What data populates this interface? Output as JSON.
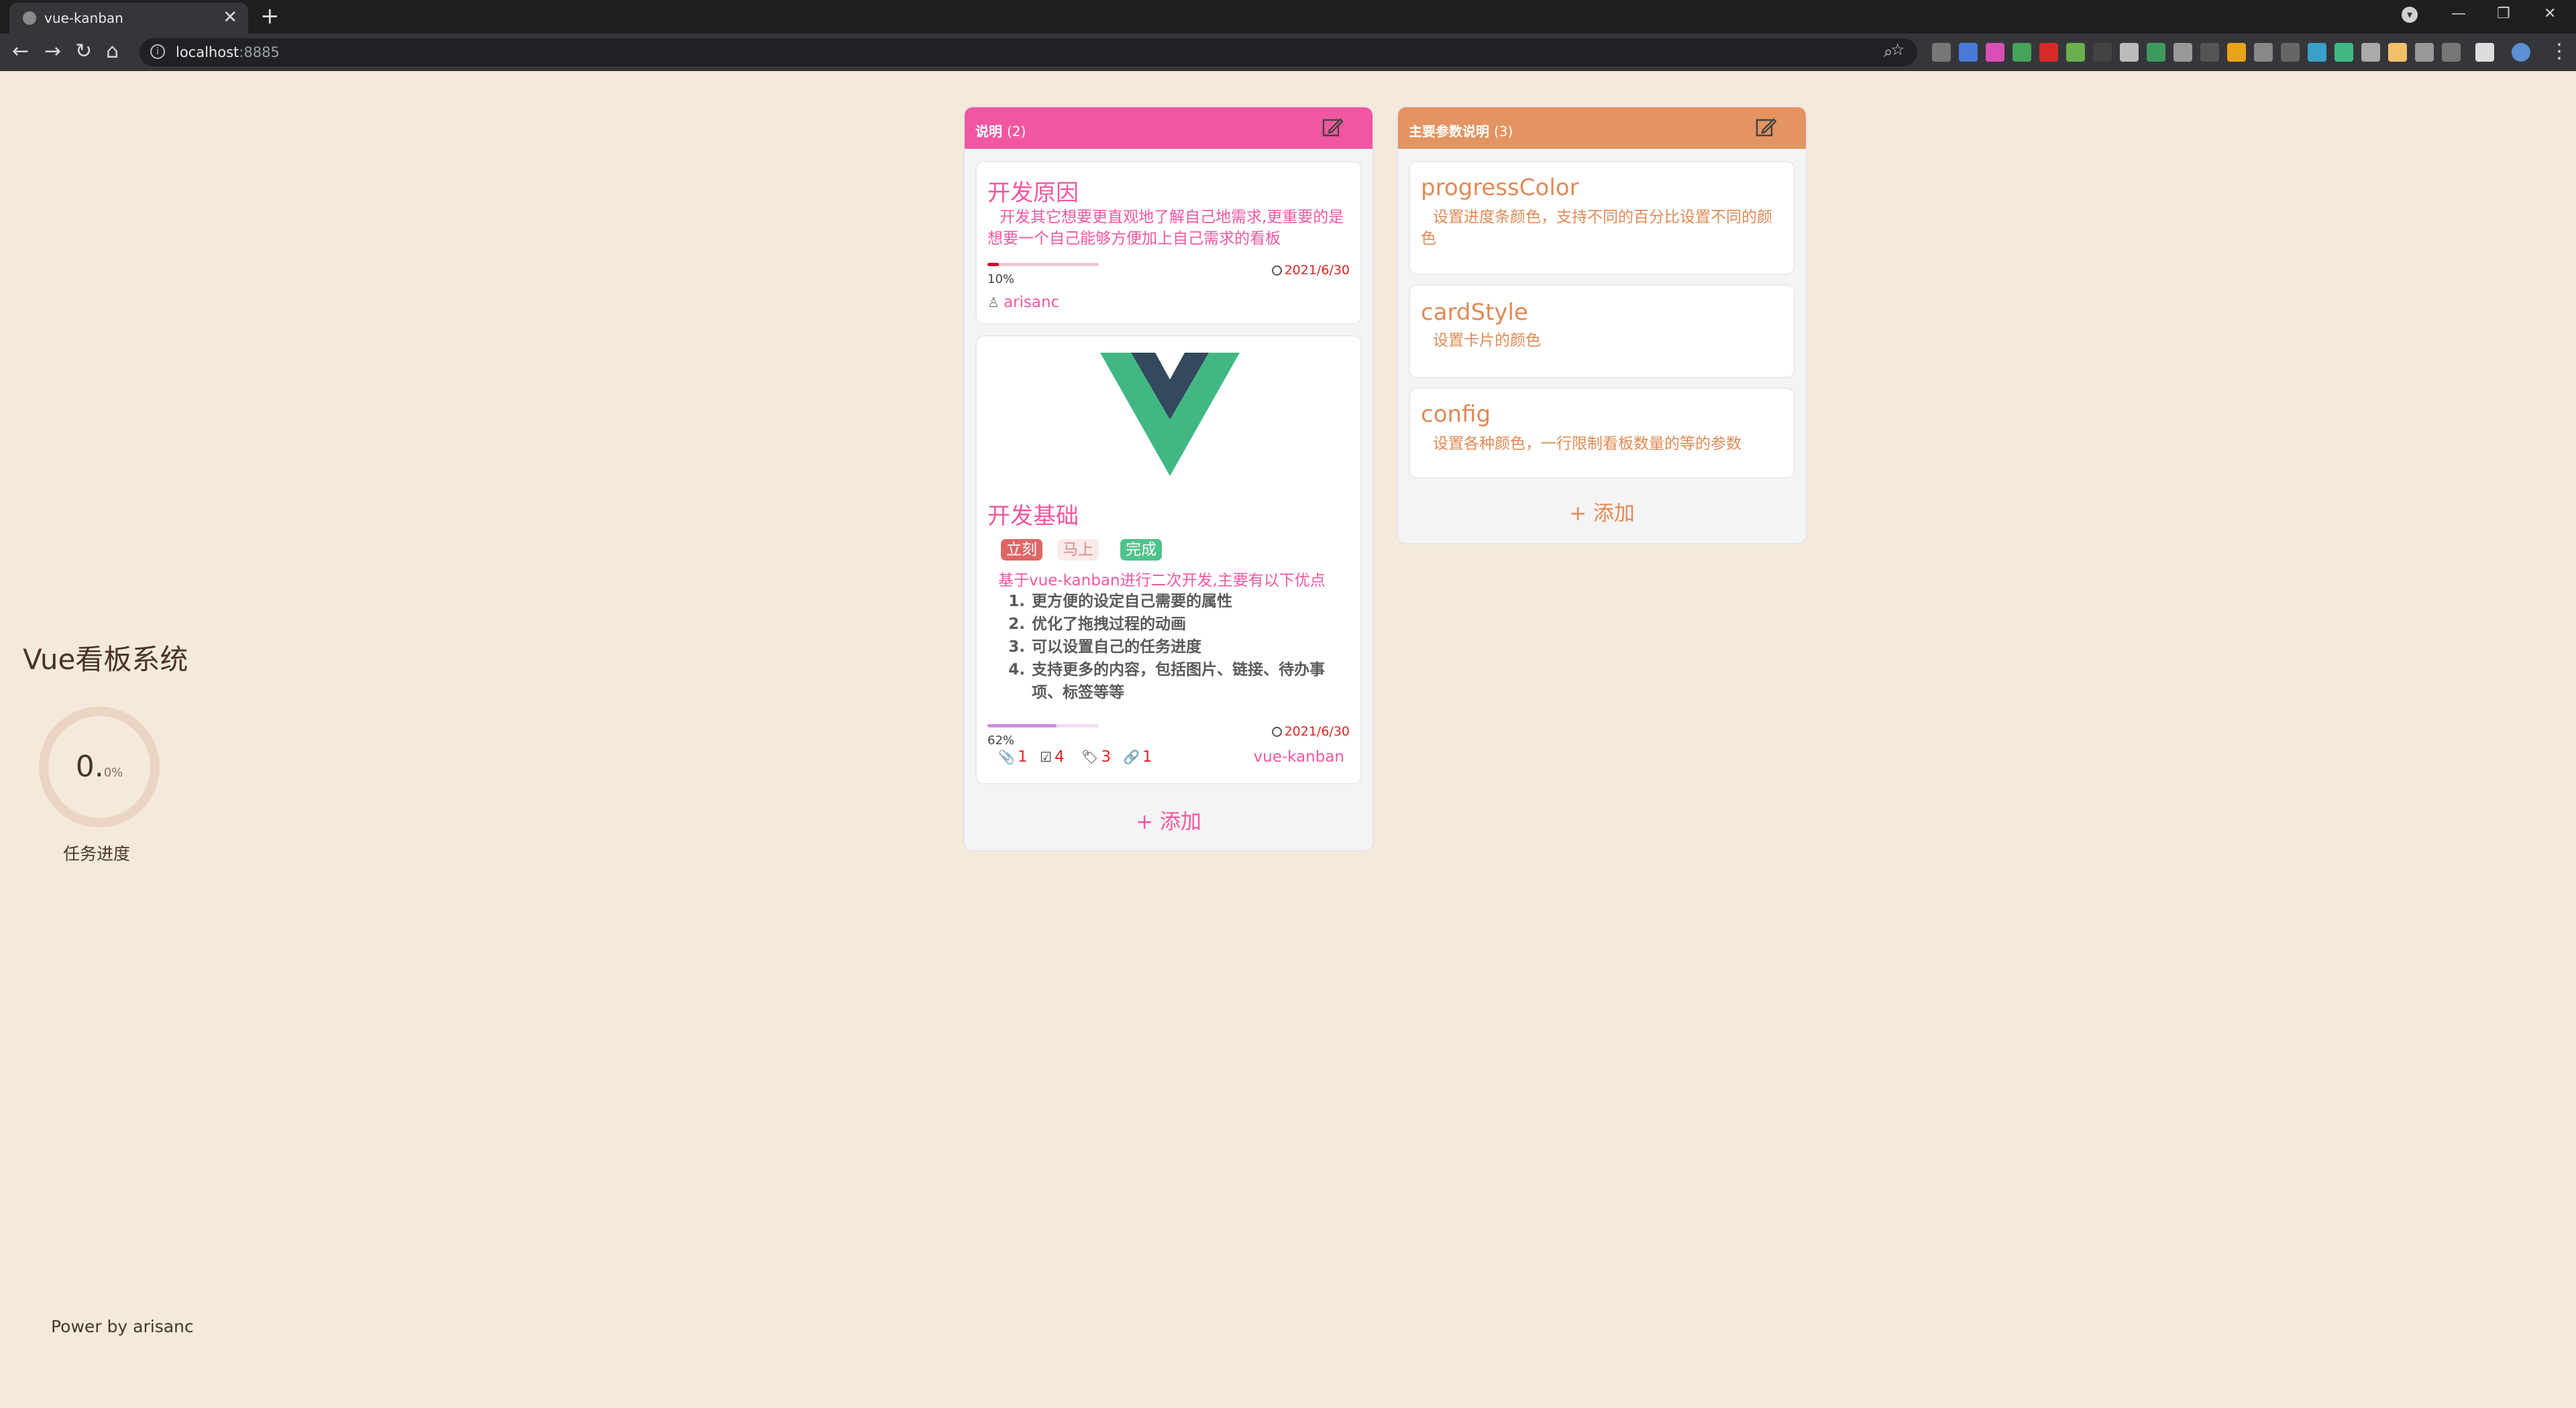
{
  "browser": {
    "tab_title": "vue-kanban",
    "url_host": "localhost",
    "url_port": ":8885"
  },
  "side": {
    "title": "Vue看板系统",
    "progress_value": "0.",
    "progress_decimal": "0%",
    "progress_label": "任务进度",
    "footer": "Power by arisanc"
  },
  "columns": [
    {
      "title": "说明",
      "count": "(2)",
      "color": "#f157a1",
      "add_label": "+ 添加",
      "cards": [
        {
          "title": "开发原因",
          "desc": "开发其它想要更直观地了解自己地需求,更重要的是想要一个自己能够方便加上自己需求的看板",
          "progress": 10,
          "progress_label": "10%",
          "progress_color": "#c8102e",
          "date": "2021/6/30",
          "user": "arisanc"
        },
        {
          "title": "开发基础",
          "tags": [
            {
              "label": "立刻",
              "bg": "#e06666",
              "fg": "#ffffff"
            },
            {
              "label": "马上",
              "bg": "#fbeaea",
              "fg": "#d88a8a"
            },
            {
              "label": "完成",
              "bg": "#4ec38a",
              "fg": "#ffffff"
            }
          ],
          "desc": "基于vue-kanban进行二次开发,主要有以下优点",
          "list": [
            "更方便的设定自己需要的属性",
            "优化了拖拽过程的动画",
            "可以设置自己的任务进度",
            "支持更多的内容，包括图片、链接、待办事项、标签等等"
          ],
          "progress": 62,
          "progress_label": "62%",
          "progress_color": "#cf8ddf",
          "date": "2021/6/30",
          "attachments": "1",
          "todos": "4",
          "labels": "3",
          "links": "1",
          "link_text": "vue-kanban"
        }
      ]
    },
    {
      "title": "主要参数说明",
      "count": "(3)",
      "color": "#e39461",
      "add_label": "+ 添加",
      "cards": [
        {
          "title": "progressColor",
          "desc": "设置进度条颜色，支持不同的百分比设置不同的颜色"
        },
        {
          "title": "cardStyle",
          "desc": "设置卡片的颜色"
        },
        {
          "title": "config",
          "desc": "设置各种颜色，一行限制看板数量的等的参数"
        }
      ]
    }
  ]
}
